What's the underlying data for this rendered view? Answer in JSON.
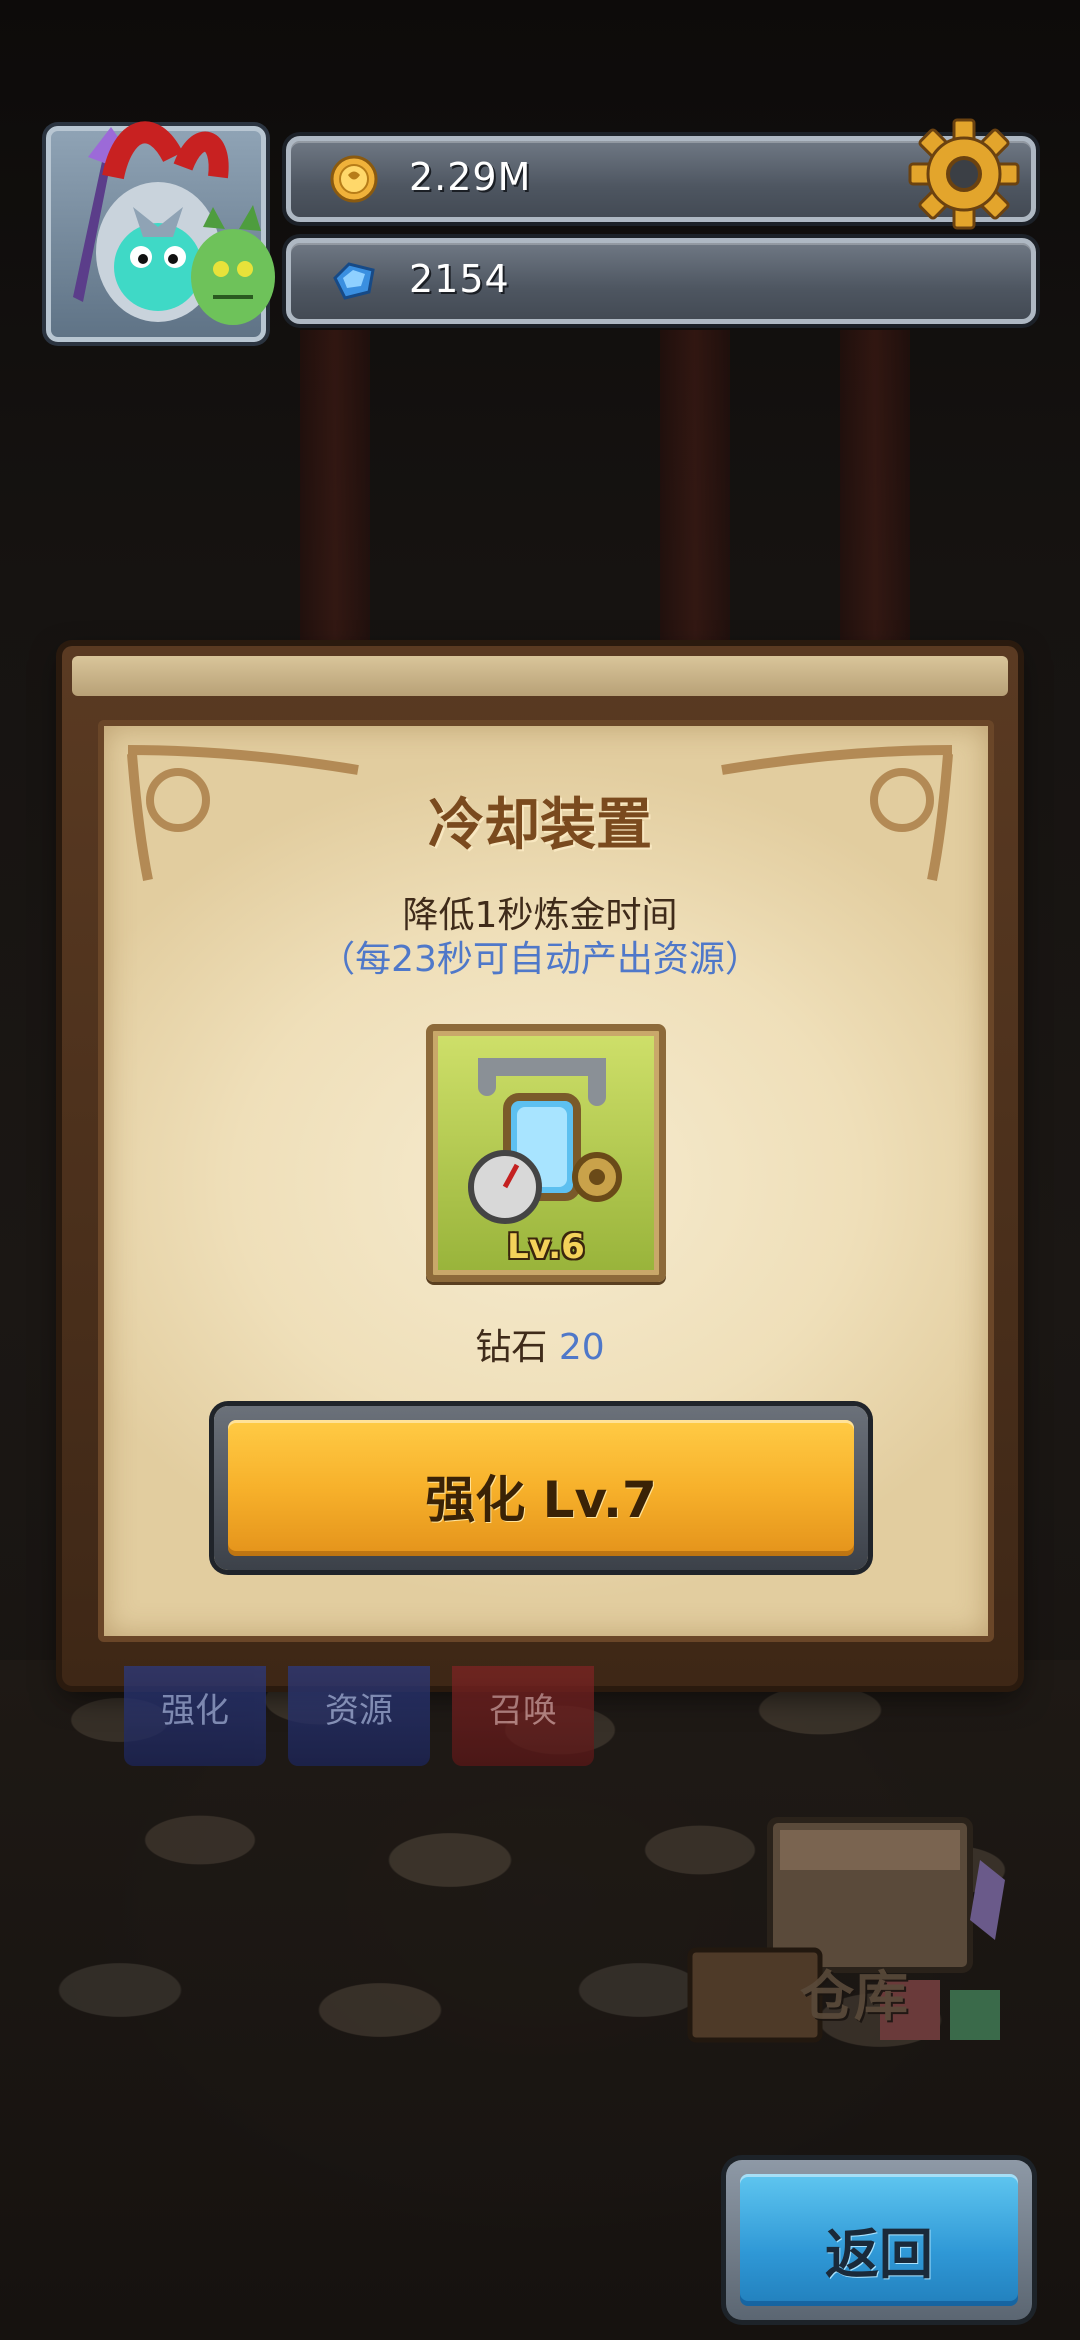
{
  "currency": {
    "gold_value": "2.29M",
    "gem_value": "2154"
  },
  "dialog": {
    "title": "冷却装置",
    "description": "降低1秒炼金时间",
    "subtext": "（每23秒可自动产出资源）",
    "item_level": "Lv.6",
    "cost_label": "钻石",
    "cost_value": "20",
    "upgrade_label": "强化 Lv.7"
  },
  "tabs": [
    {
      "label": "强化"
    },
    {
      "label": "资源"
    },
    {
      "label": "召唤"
    }
  ],
  "warehouse_label": "仓库",
  "return_label": "返回",
  "colors": {
    "accent_blue": "#4f78c9",
    "upgrade_yellow": "#f7b12b",
    "return_blue": "#2f98d6"
  },
  "icons": [
    "avatar",
    "gold-coin-icon",
    "gem-icon",
    "gear-icon",
    "cooling-device-icon"
  ]
}
